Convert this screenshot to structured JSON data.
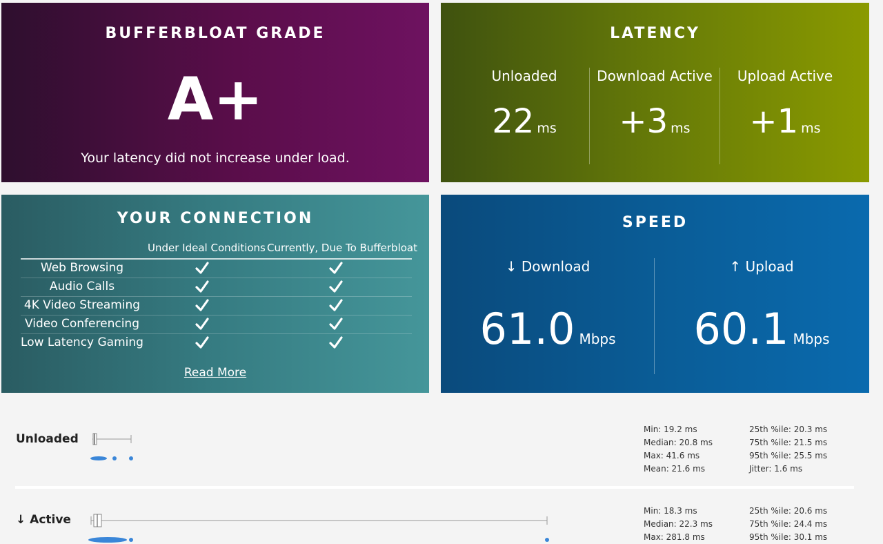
{
  "grade": {
    "title": "BUFFERBLOAT GRADE",
    "grade": "A+",
    "message": "Your latency did not increase under load."
  },
  "latency": {
    "title": "LATENCY",
    "cols": [
      {
        "label": "Unloaded",
        "value": "22",
        "unit": "ms"
      },
      {
        "label": "Download Active",
        "value": "+3",
        "unit": "ms"
      },
      {
        "label": "Upload Active",
        "value": "+1",
        "unit": "ms"
      }
    ]
  },
  "connection": {
    "title": "YOUR CONNECTION",
    "col_ideal": "Under Ideal Conditions",
    "col_current": "Currently, Due To Bufferbloat",
    "rows": [
      {
        "label": "Web Browsing"
      },
      {
        "label": "Audio Calls"
      },
      {
        "label": "4K Video Streaming"
      },
      {
        "label": "Video Conferencing"
      },
      {
        "label": "Low Latency Gaming"
      }
    ],
    "read_more": "Read More"
  },
  "speed": {
    "title": "SPEED",
    "download_label": "↓ Download",
    "download_value": "61.0",
    "download_unit": "Mbps",
    "upload_label": "↑ Upload",
    "upload_value": "60.1",
    "upload_unit": "Mbps"
  },
  "stats": {
    "unloaded": {
      "label": "Unloaded",
      "min": "Min: 19.2 ms",
      "median": "Median: 20.8 ms",
      "max": "Max: 41.6 ms",
      "mean": "Mean: 21.6 ms",
      "p25": "25th %ile: 20.3 ms",
      "p75": "75th %ile: 21.5 ms",
      "p95": "95th %ile: 25.5 ms",
      "jitter": "Jitter: 1.6 ms"
    },
    "active_down": {
      "label": "↓ Active",
      "min": "Min: 18.3 ms",
      "median": "Median: 22.3 ms",
      "max": "Max: 281.8 ms",
      "p25": "25th %ile: 20.6 ms",
      "p75": "75th %ile: 24.4 ms",
      "p95": "95th %ile: 30.1 ms"
    }
  },
  "colors": {
    "grade_bg": "#5a0d4a",
    "latency_bg": "#667a08",
    "connection_bg": "#367c82",
    "speed_bg": "#0a5c96",
    "dot": "#3a86d8"
  }
}
